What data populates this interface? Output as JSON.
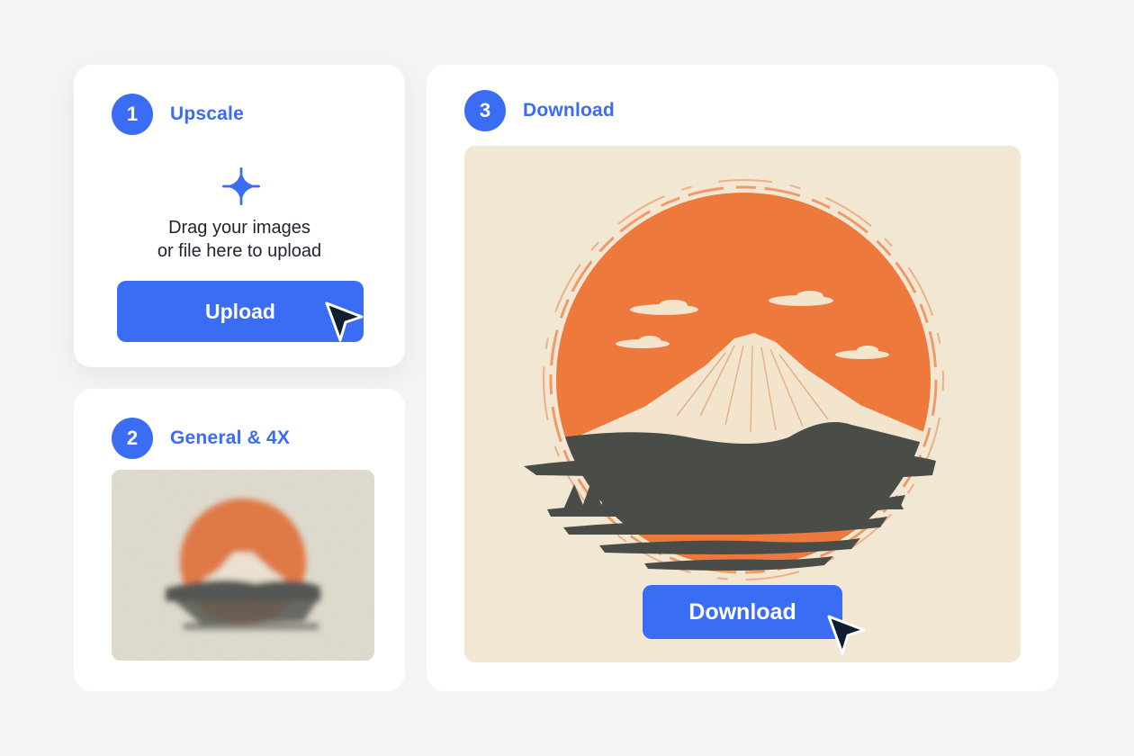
{
  "steps": [
    {
      "number": "1",
      "title": "Upscale"
    },
    {
      "number": "2",
      "title": "General & 4X"
    },
    {
      "number": "3",
      "title": "Download"
    }
  ],
  "upload": {
    "line1": "Drag your images",
    "line2": "or file here to upload",
    "button_label": "Upload",
    "plus_icon": "sparkle-plus-icon"
  },
  "download": {
    "button_label": "Download"
  },
  "colors": {
    "accent": "#3a6cf4",
    "sun_orange": "#ed7a3c",
    "mountain_cream": "#f3e4cd",
    "hill_dark": "#4a4c48",
    "canvas_bg": "#f1e7d2",
    "cursor": "#0f1f2e"
  }
}
